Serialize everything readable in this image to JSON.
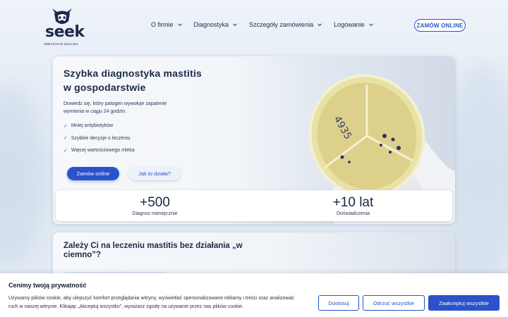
{
  "header": {
    "logo_text": "seek",
    "logo_subtitle": "SEBASTIAN SKULSKI",
    "nav": [
      {
        "label": "O firmie"
      },
      {
        "label": "Diagnostyka"
      },
      {
        "label": "Szczegóły zamówienia"
      },
      {
        "label": "Logowanie"
      }
    ],
    "order_button": "ZAMÓW ONLINE"
  },
  "hero": {
    "title": "Szybka diagnostyka mastitis w gospodarstwie",
    "description": "Dowiedz się, który patogen wywołuje zapalenie wymienia w ciągu 24 godzin.",
    "benefits": [
      "Mniej antybiotyków",
      "Szybkie decyzje o leczeniu",
      "Więcej wartościowego mleka"
    ],
    "primary_button": "Zamów online",
    "secondary_button": "Jak to działa?",
    "stats": [
      {
        "value": "+500",
        "label": "Diagnoz miesięcznie"
      },
      {
        "value": "+10 lat",
        "label": "Doświadczenia"
      }
    ],
    "image_icon": "petri-dish-in-gloved-hand"
  },
  "section2": {
    "title": "Zależy Ci na leczeniu mastitis bez działania „w ciemno”?"
  },
  "cookie": {
    "title": "Cenimy twoją prywatność",
    "text": "Używamy plików cookie, aby ulepszyć komfort przeglądania witryny, wyświetlać spersonalizowane reklamy i treści oraz analizować ruch w naszej witrynie. Klikając „Akceptuj wszystko”, wyrażasz zgodę na używanie przez nas plików cookie.",
    "buttons": {
      "customize": "Dostosuj",
      "reject": "Odrzuć wszystkie",
      "accept": "Zaakceptuj wszystkie"
    }
  },
  "colors": {
    "accent": "#2a52c9",
    "navy": "#1c2a48"
  }
}
